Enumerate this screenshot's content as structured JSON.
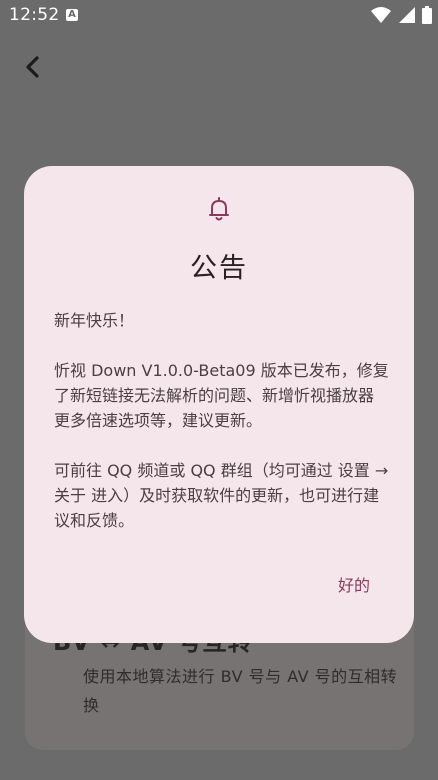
{
  "status_bar": {
    "time": "12:52",
    "notification_icon": "a-badge-icon",
    "icons": [
      "wifi-icon",
      "signal-icon",
      "battery-icon"
    ]
  },
  "top_bar": {
    "back_icon": "back-arrow-icon"
  },
  "background_card": {
    "title": "BV ↔ AV 号互转",
    "description": "使用本地算法进行 BV 号与 AV 号的互相转换"
  },
  "dialog": {
    "icon": "bell-icon",
    "title": "公告",
    "paragraphs": [
      "新年快乐！",
      "忻视 Down V1.0.0-Beta09 版本已发布，修复了新短链接无法解析的问题、新增忻视播放器更多倍速选项等，建议更新。",
      "可前往 QQ 频道或 QQ 群组（均可通过 设置 → 关于 进入）及时获取软件的更新，也可进行建议和反馈。"
    ],
    "ok_label": "好的"
  },
  "colors": {
    "scrim": "#6b6b6b",
    "dialog_bg": "#f5e6ec",
    "accent": "#8a3a5c"
  }
}
